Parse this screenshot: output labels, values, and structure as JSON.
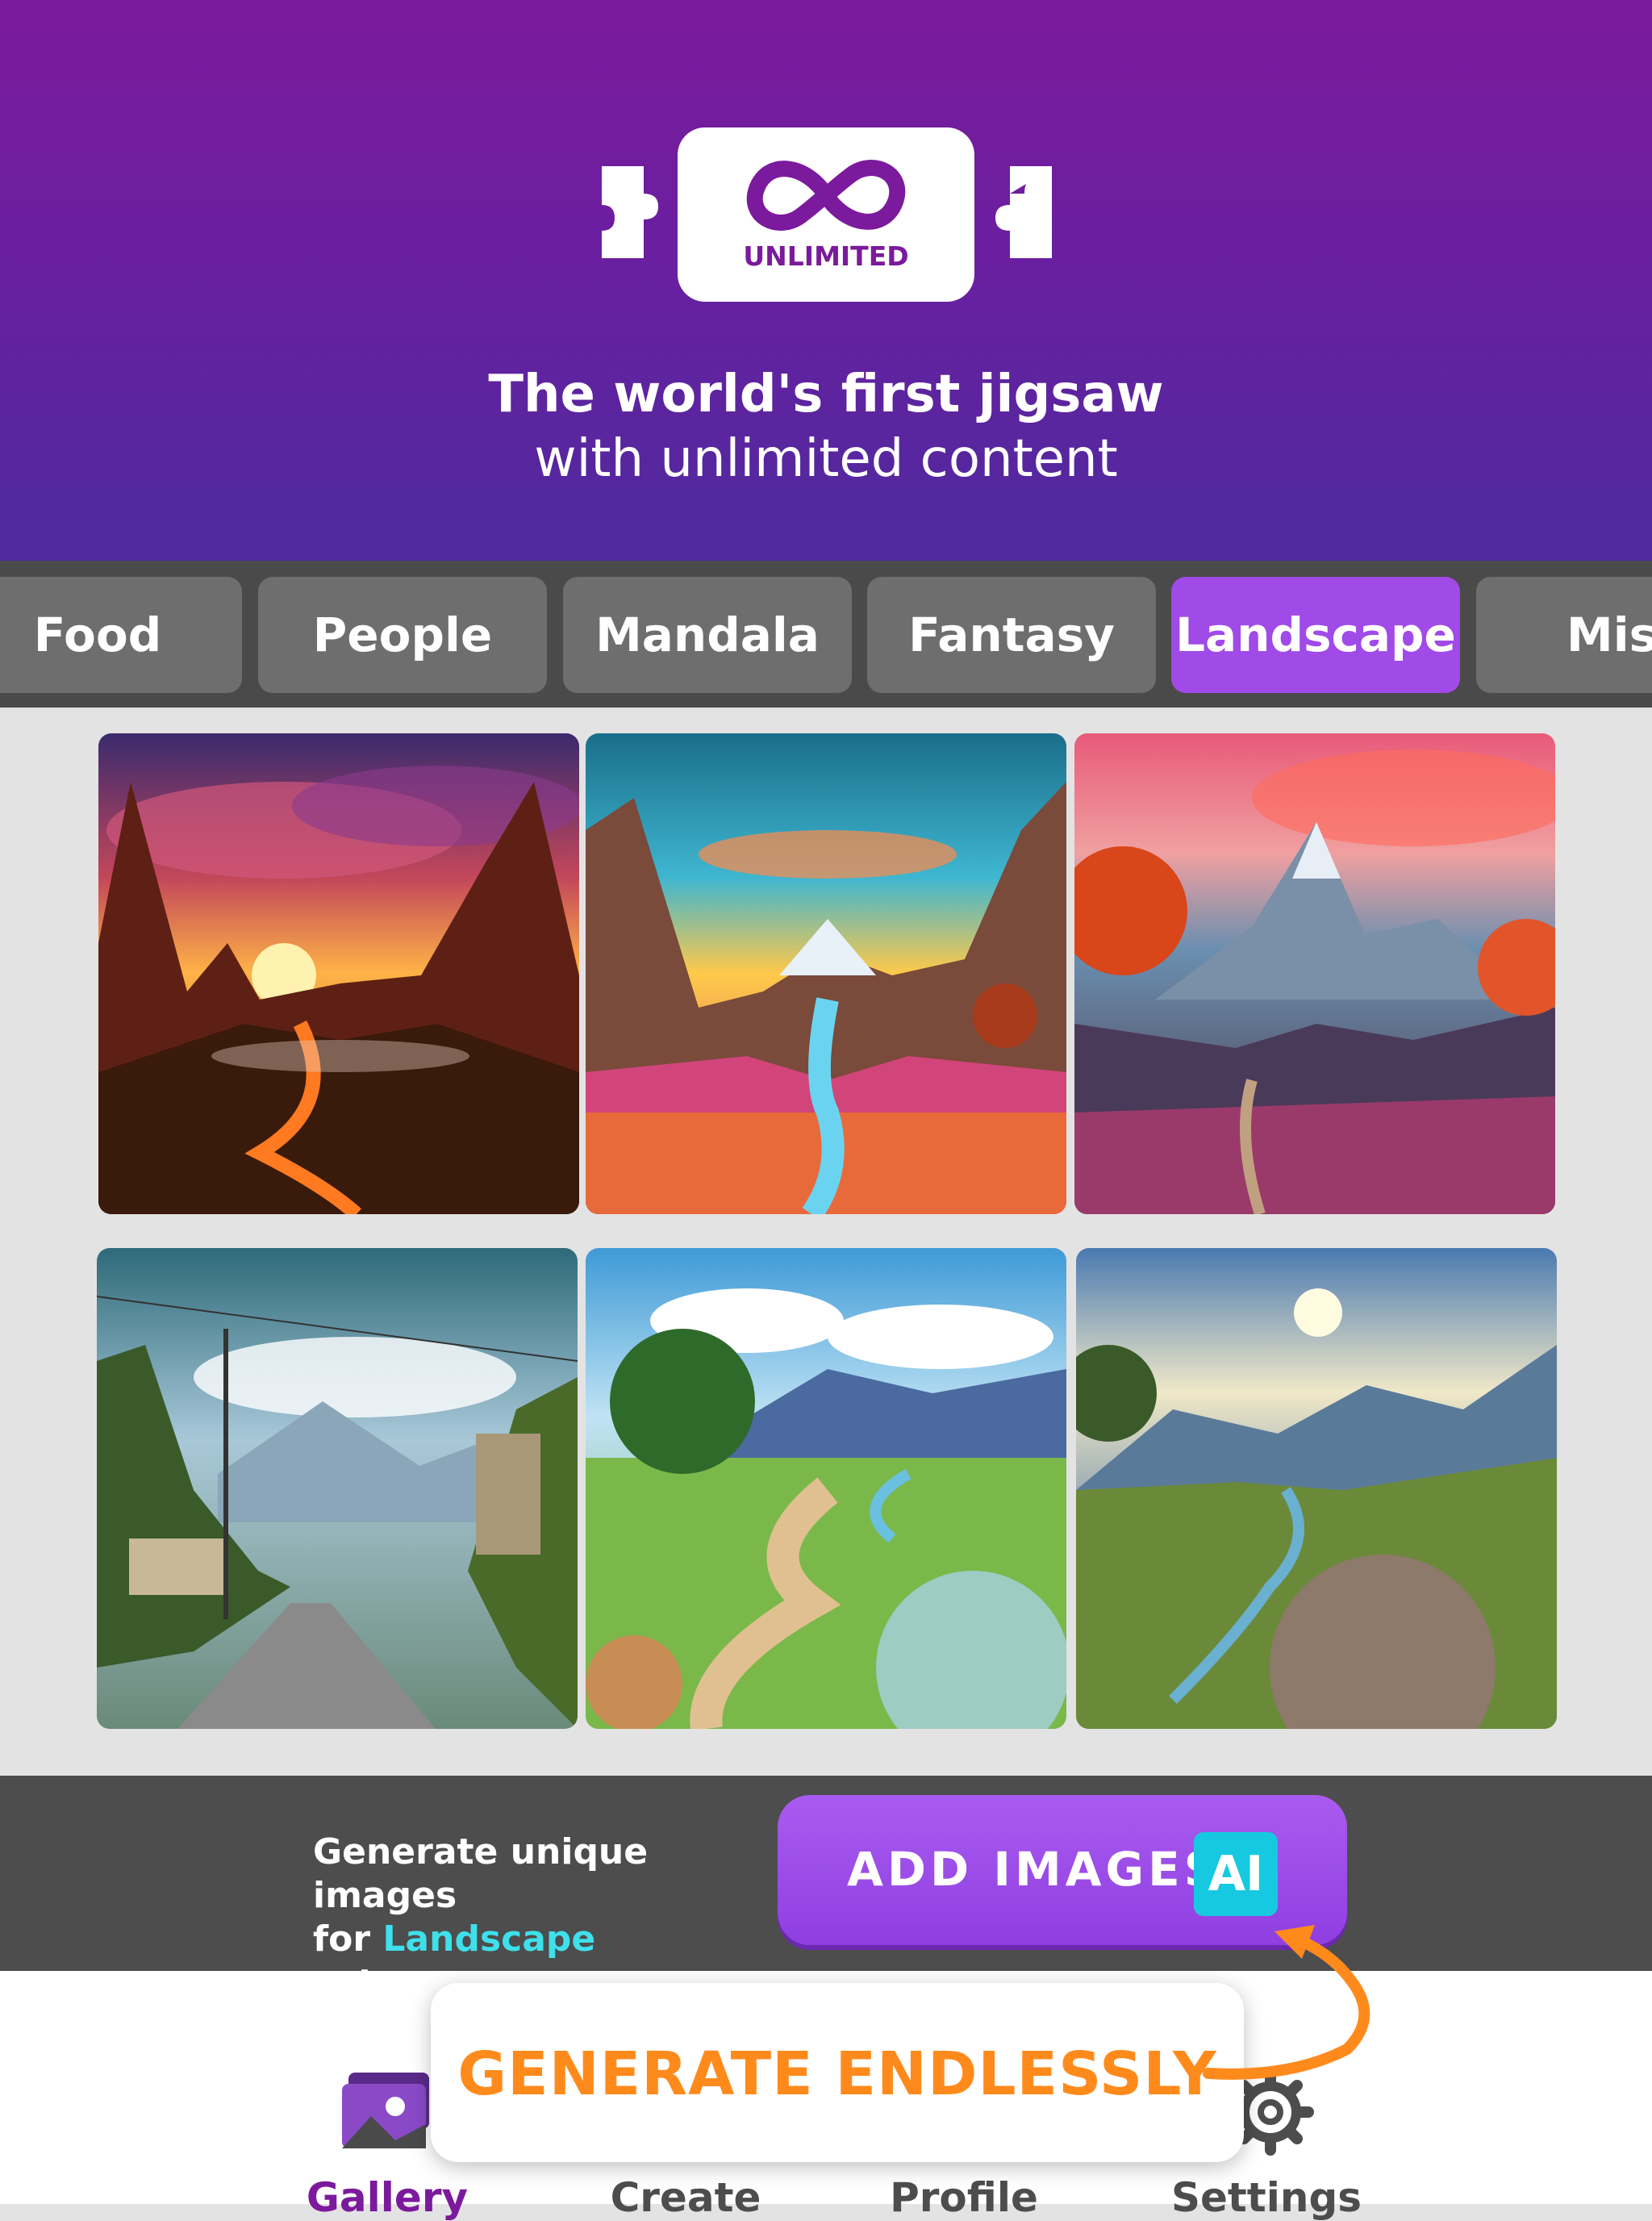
{
  "header": {
    "logo_text": "UNLIMITED",
    "tagline_bold": "The world's first jigsaw",
    "tagline_regular": "with unlimited content"
  },
  "categories": [
    {
      "label": "Food",
      "active": false
    },
    {
      "label": "People",
      "active": false
    },
    {
      "label": "Mandala",
      "active": false
    },
    {
      "label": "Fantasy",
      "active": false
    },
    {
      "label": "Landscape",
      "active": true
    },
    {
      "label": "Misc",
      "active": false
    }
  ],
  "gallery": {
    "images": [
      {
        "name": "fantasy-red-mountains-sunset"
      },
      {
        "name": "colorful-valley-waterfall"
      },
      {
        "name": "purple-mountain-autumn-valley"
      },
      {
        "name": "country-road-power-lines"
      },
      {
        "name": "green-valley-river-path"
      },
      {
        "name": "meadow-stream-sunny-sky"
      }
    ]
  },
  "generate_bar": {
    "line1": "Generate unique images",
    "line2_prefix": "for ",
    "line2_category": "Landscape",
    "line2_suffix": " category",
    "button_label": "ADD IMAGES",
    "badge": "AI"
  },
  "tabs": [
    {
      "label": "Gallery",
      "icon": "gallery-icon",
      "active": true
    },
    {
      "label": "Create",
      "icon": "create-icon",
      "active": false
    },
    {
      "label": "Profile",
      "icon": "profile-icon",
      "active": false
    },
    {
      "label": "Settings",
      "icon": "gear-icon",
      "active": false
    }
  ],
  "callout": {
    "text": "GENERATE ENDLESSLY"
  },
  "colors": {
    "brand_purple": "#7b1a9c",
    "active_tab": "#a04ae8",
    "accent_orange": "#ff8a1c",
    "accent_cyan": "#3ee0ea"
  }
}
